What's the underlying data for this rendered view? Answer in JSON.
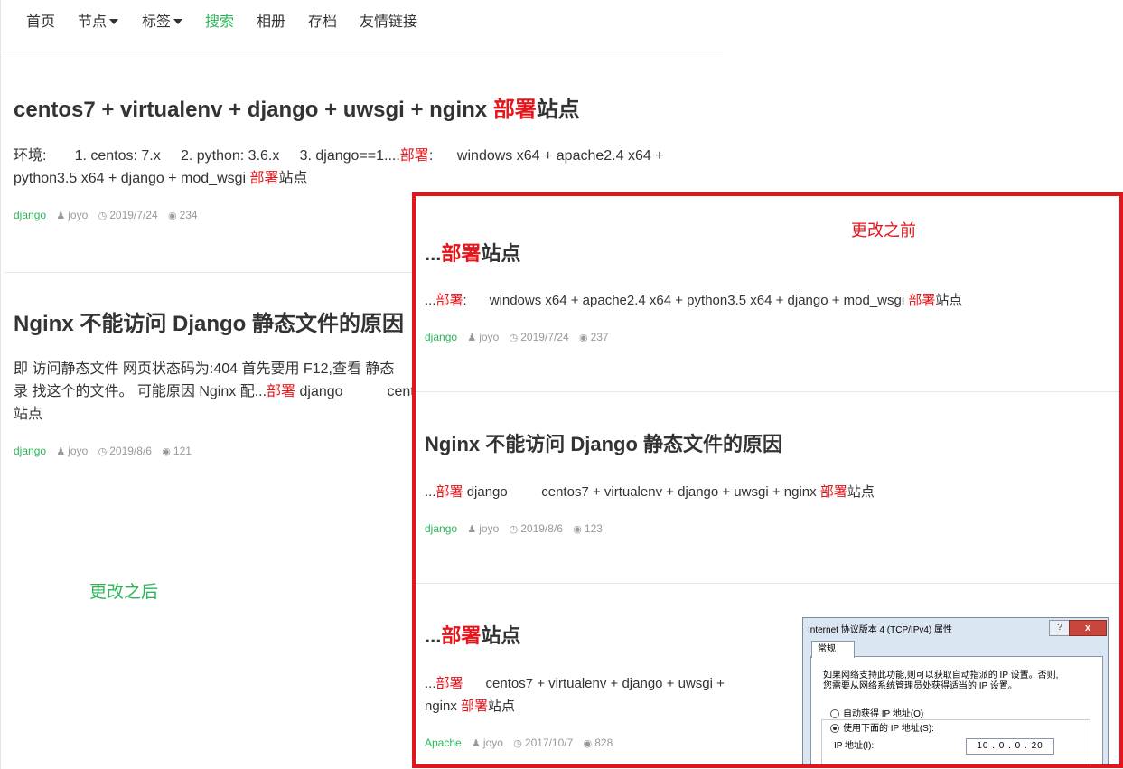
{
  "nav": {
    "items": [
      {
        "label": "首页"
      },
      {
        "label": "节点"
      },
      {
        "label": "标签"
      },
      {
        "label": "搜索"
      },
      {
        "label": "相册"
      },
      {
        "label": "存档"
      },
      {
        "label": "友情链接"
      }
    ]
  },
  "colors": {
    "accent": "#2bb559",
    "highlight": "#e4161c",
    "text": "#333333",
    "muted": "#999999"
  },
  "after": {
    "note": "更改之后",
    "posts": [
      {
        "title_pre": "centos7 + virtualenv + django + uwsgi + nginx ",
        "title_hl": "部署",
        "title_post": "站点",
        "excerpt_1": "环境:       1. centos: 7.x     2. python: 3.6.x     3. django==1....",
        "excerpt_hl1": "部署",
        "excerpt_2": ":      windows x64 + apache2.4 x64 + python3.5 x64 + django + mod_wsgi ",
        "excerpt_hl2": "部署",
        "excerpt_3": "站点",
        "tag": "django",
        "author": "joyo",
        "date": "2019/7/24",
        "views": "234"
      },
      {
        "title": "Nginx 不能访问 Django 静态文件的原因",
        "excerpt_1": "即 访问静态文件 网页状态码为:404 首先要用 F12,查看 静态",
        "excerpt_2": "录 找这个的文件。 可能原因 Nginx 配...",
        "excerpt_hl": "部署",
        "excerpt_3": " django           centos",
        "excerpt_4": "站点",
        "tag": "django",
        "author": "joyo",
        "date": "2019/8/6",
        "views": "121"
      }
    ]
  },
  "before": {
    "note": "更改之前",
    "posts": [
      {
        "title_pre": "...",
        "title_hl": "部署",
        "title_post": "站点",
        "excerpt_pre": "...",
        "excerpt_hl1": "部署",
        "excerpt_mid": ":      windows x64 + apache2.4 x64 + python3.5 x64 + django + mod_wsgi ",
        "excerpt_hl2": "部署",
        "excerpt_post": "站点",
        "tag": "django",
        "author": "joyo",
        "date": "2019/7/24",
        "views": "237"
      },
      {
        "title": "Nginx 不能访问 Django 静态文件的原因",
        "excerpt_pre": "...",
        "excerpt_hl1": "部署",
        "excerpt_mid": " django         centos7 + virtualenv + django + uwsgi + nginx ",
        "excerpt_hl2": "部署",
        "excerpt_post": "站点",
        "tag": "django",
        "author": "joyo",
        "date": "2019/8/6",
        "views": "123"
      },
      {
        "title_pre": "...",
        "title_hl": "部署",
        "title_post": "站点",
        "excerpt_pre": "...",
        "excerpt_hl1": "部署",
        "excerpt_mid": "      centos7 + virtualenv + django + uwsgi +",
        "excerpt_line2": "nginx ",
        "excerpt_hl2": "部署",
        "excerpt_post": "站点",
        "tag": "Apache",
        "author": "joyo",
        "date": "2017/10/7",
        "views": "828"
      }
    ]
  },
  "dialog": {
    "title": "Internet 协议版本 4 (TCP/IPv4) 属性",
    "help": "?",
    "close": "x",
    "tab": "常规",
    "desc_1": "如果网络支持此功能,则可以获取自动指派的 IP 设置。否则,",
    "desc_2": "您需要从网络系统管理员处获得适当的 IP 设置。",
    "radio_auto": "自动获得 IP 地址(O)",
    "radio_manual": "使用下面的 IP 地址(S):",
    "ip_label": "IP 地址(I):",
    "ip_value": "10 . 0 . 0 . 20"
  }
}
